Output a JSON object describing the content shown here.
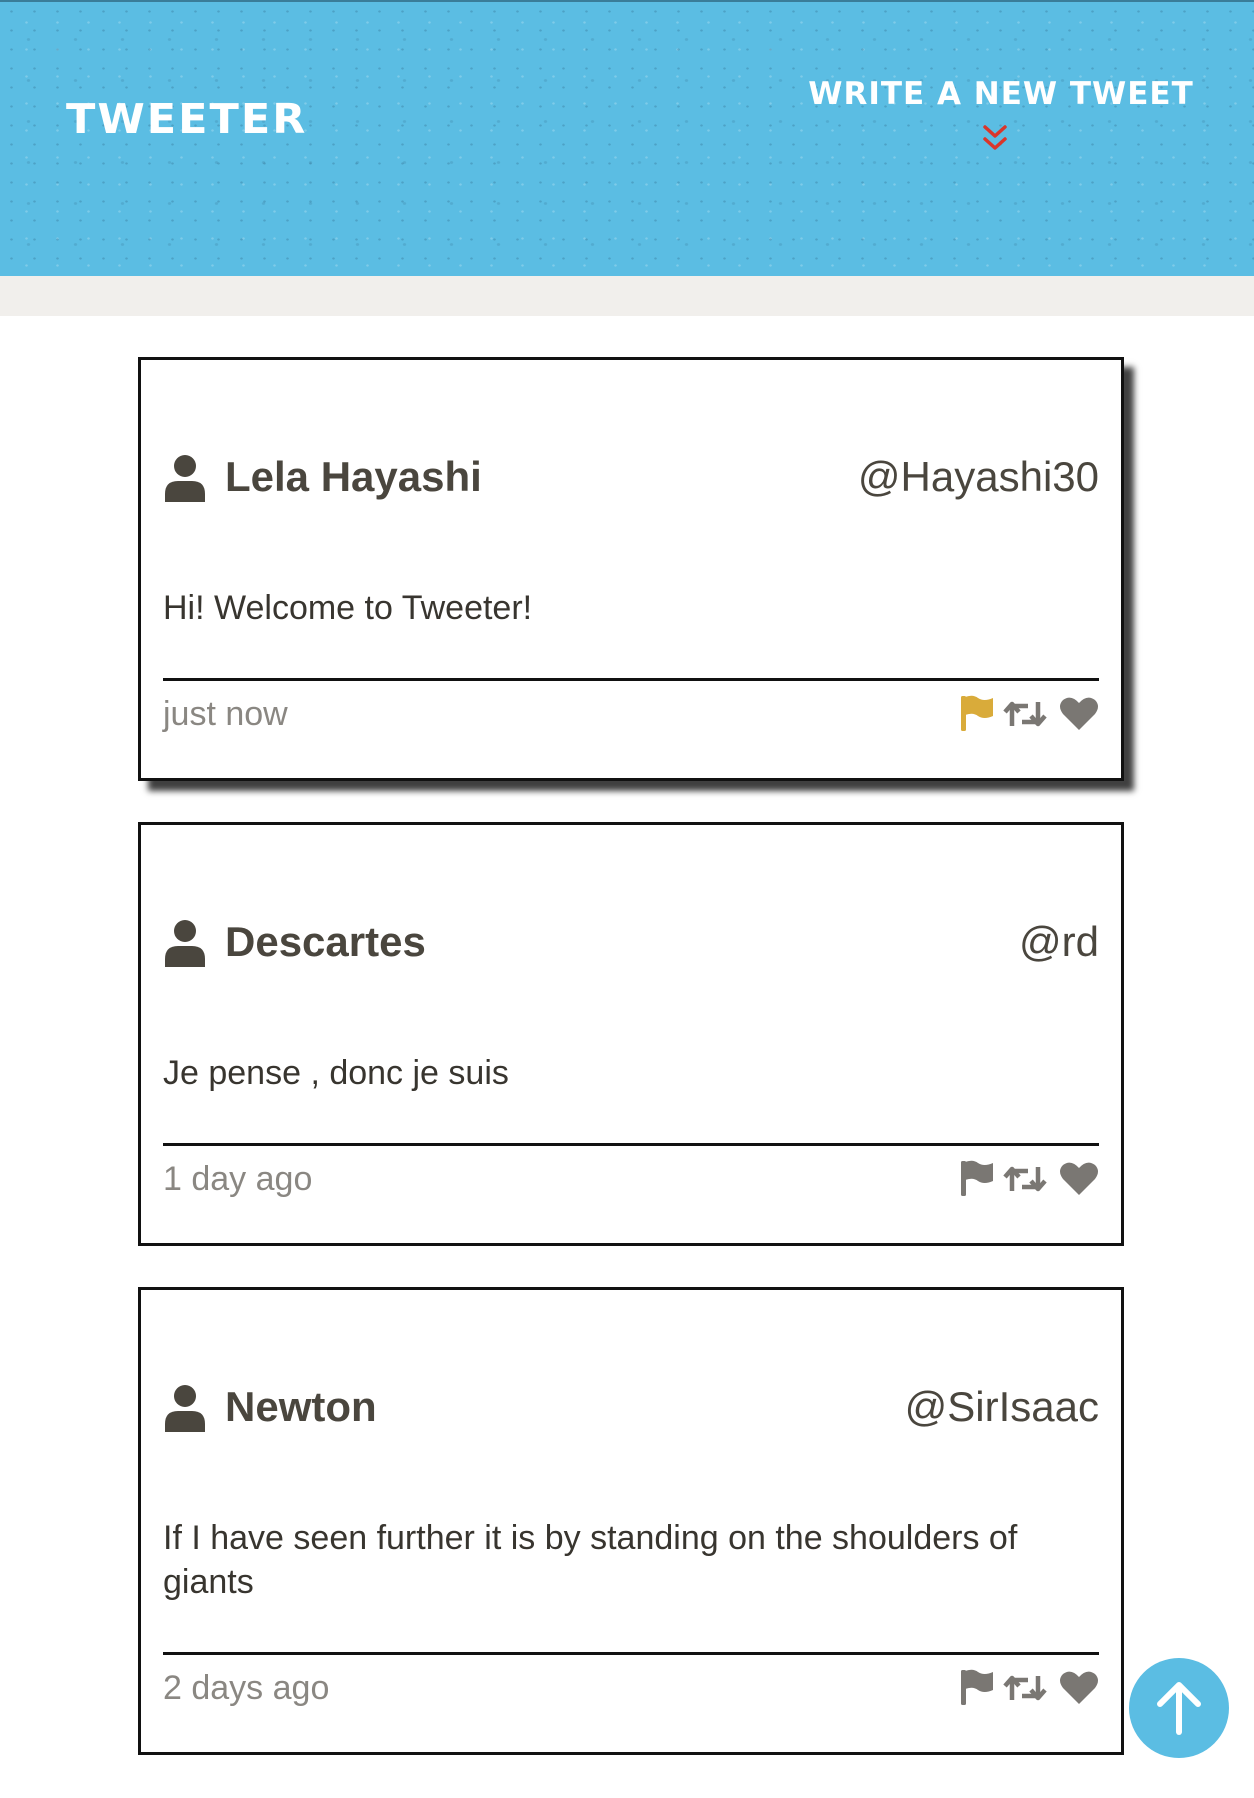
{
  "header": {
    "logo": "Tweeter",
    "compose_label": "Write a new tweet",
    "chevron_icon": "double-chevron-down-icon",
    "chevron_color": "#d9362b"
  },
  "colors": {
    "brand": "#5bbde3",
    "flag_active": "#d9ab3a",
    "icon_default": "#7a7773",
    "text": "#4a463e"
  },
  "tweets": [
    {
      "name": "Lela Hayashi",
      "handle": "@Hayashi30",
      "text": "Hi! Welcome to Tweeter!",
      "time": "just now",
      "flag_active": true
    },
    {
      "name": "Descartes",
      "handle": "@rd",
      "text": "Je pense , donc je suis",
      "time": "1 day ago",
      "flag_active": false
    },
    {
      "name": "Newton",
      "handle": "@SirIsaac",
      "text": "If I have seen further it is by standing on the shoulders of giants",
      "time": "2 days ago",
      "flag_active": false
    }
  ],
  "scroll_top": {
    "icon": "arrow-up-icon"
  }
}
